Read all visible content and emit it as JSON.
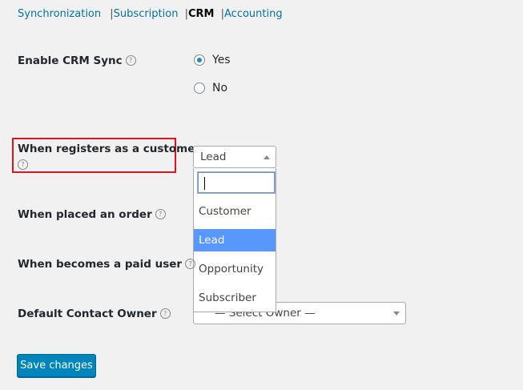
{
  "tabs": [
    {
      "label": "Synchronization"
    },
    {
      "label": "Subscription"
    },
    {
      "label": "CRM"
    },
    {
      "label": "Accounting"
    }
  ],
  "separator": "|",
  "help_glyph": "?",
  "fields": {
    "enable_crm_sync": {
      "label": "Enable CRM Sync",
      "options": [
        "Yes",
        "No"
      ],
      "selected": "Yes"
    },
    "registers_customer": {
      "label": "When registers as a customer",
      "value": "Lead",
      "dropdown_search_value": "",
      "dropdown_options": [
        "Customer",
        "Lead",
        "Opportunity",
        "Subscriber"
      ],
      "highlighted_option": "Lead"
    },
    "placed_order": {
      "label": "When placed an order"
    },
    "paid_user": {
      "label": "When becomes a paid user"
    },
    "contact_owner": {
      "label": "Default Contact Owner",
      "placeholder": "— Select Owner —"
    }
  },
  "save_button": "Save changes",
  "colors": {
    "link": "#0073aa",
    "highlight_box": "#e0141e",
    "button": "#0085ba",
    "selected_option": "#5897fb"
  }
}
